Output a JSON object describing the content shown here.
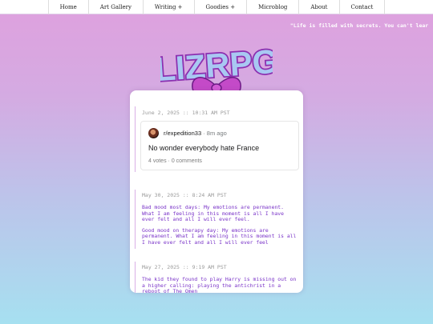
{
  "nav": {
    "items": [
      {
        "label": "Home"
      },
      {
        "label": "Art Gallery"
      },
      {
        "label": "Writing +"
      },
      {
        "label": "Goodies +"
      },
      {
        "label": "Microblog"
      },
      {
        "label": "About"
      },
      {
        "label": "Contact"
      }
    ]
  },
  "marquee": {
    "text": "\"Life is filled with secrets. You can't lear"
  },
  "logo": {
    "text": "LIZRPG",
    "colors": {
      "fill": "#a9c8f2",
      "outline": "#8c2fb0",
      "bow": "#c44ac8"
    }
  },
  "posts": [
    {
      "date": "June 2, 2025 :: 10:31 AM PST",
      "embed": {
        "user": "r/expedition33",
        "separator": " · ",
        "ago": "8m ago",
        "title": "No wonder everybody hate France",
        "votes": "4 votes",
        "comments": "0 comments"
      }
    },
    {
      "date": "May 30, 2025 :: 8:24 AM PST",
      "paragraphs": [
        "Bad mood most days: My emotions are permanent. What I am feeling in this moment is all I have ever felt and all I will ever feel.",
        "Good mood on therapy day: My emotions are permanent. What I am feeling in this moment is all I have ever felt and all I will ever feel"
      ]
    },
    {
      "date": "May 27, 2025 :: 9:19 AM PST",
      "paragraphs": [
        "The kid they found to play Harry is missing out on a higher calling: playing the antichrist in a reboot of The Omen"
      ]
    }
  ]
}
